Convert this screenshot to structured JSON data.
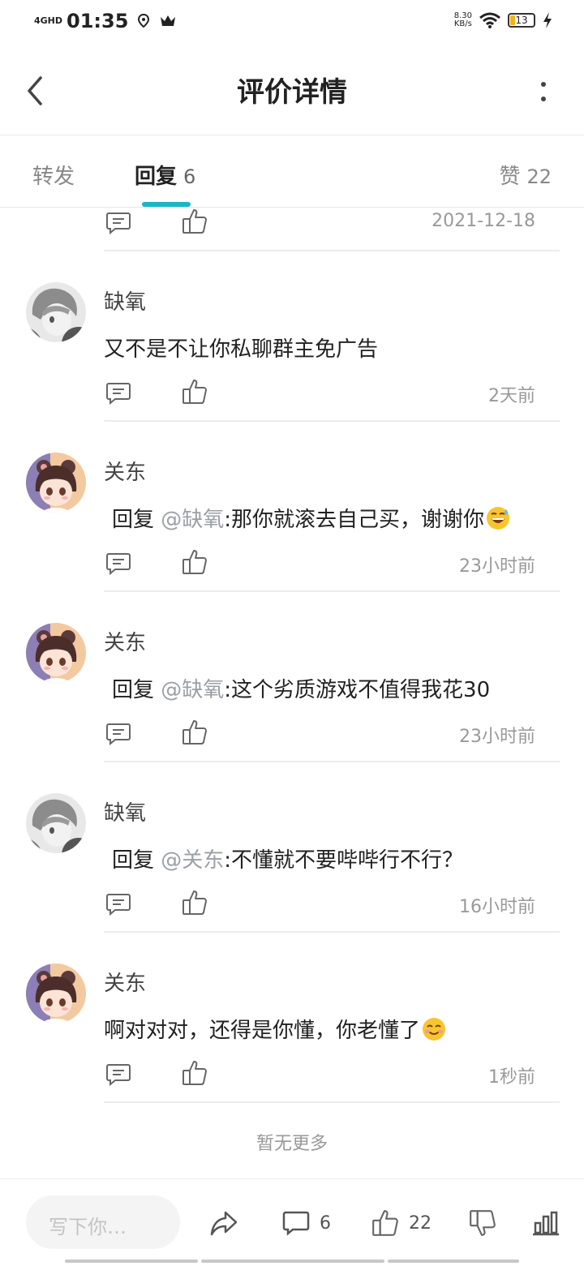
{
  "status_bar": {
    "network": "4GHD",
    "time": "01:35",
    "speed_value": "8.30",
    "speed_unit": "KB/s",
    "battery": "13"
  },
  "header": {
    "title": "评价详情"
  },
  "tabs": {
    "forward_label": "转发",
    "reply_label": "回复",
    "reply_count": "6",
    "like_label": "赞",
    "like_count": "22"
  },
  "top_partial": {
    "time": "2021-12-18"
  },
  "replies": [
    {
      "user": "缺氧",
      "prefix": "",
      "mention": "",
      "text": "又不是不让你私聊群主免广告",
      "emoji": "",
      "time": "2天前"
    },
    {
      "user": "关东",
      "prefix": "回复 ",
      "mention": "@缺氧",
      "text": ":那你就滚去自己买，谢谢你",
      "emoji": "sweat-smile-emoji",
      "time": "23小时前"
    },
    {
      "user": "关东",
      "prefix": "回复 ",
      "mention": "@缺氧",
      "text": ":这个劣质游戏不值得我花30",
      "emoji": "",
      "time": "23小时前"
    },
    {
      "user": "缺氧",
      "prefix": "回复 ",
      "mention": "@关东",
      "text": ":不懂就不要哔哔行不行？",
      "emoji": "",
      "time": "16小时前"
    },
    {
      "user": "关东",
      "prefix": "",
      "mention": "",
      "text": "啊对对对，还得是你懂，你老懂了",
      "emoji": "smile-emoji",
      "time": "1秒前"
    }
  ],
  "footer_note": "暂无更多",
  "bottom_bar": {
    "input_placeholder": "写下你…",
    "comment_count": "6",
    "like_count": "22"
  },
  "colors": {
    "accent": "#1bb5c6",
    "mention": "#9aa0a6",
    "muted": "#999999"
  }
}
